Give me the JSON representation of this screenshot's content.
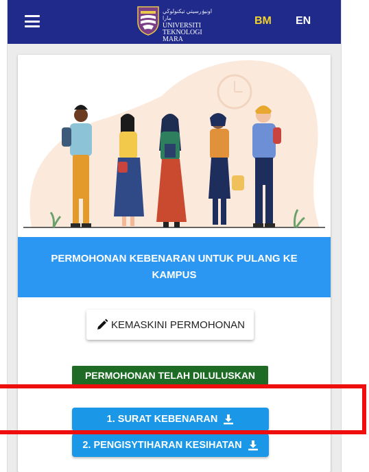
{
  "navbar": {
    "logo": {
      "arabic": "اونيۏرسيتي تيكنولوڬي مارا",
      "line1": "UNIVERSITI",
      "line2": "TEKNOLOGI",
      "line3": "MARA"
    },
    "lang_bm": "BM",
    "lang_en": "EN",
    "colors": {
      "bar": "#1f2a8a",
      "active_lang": "#f4d22e"
    }
  },
  "banner": {
    "title": "PERMOHONAN KEBENARAN UNTUK PULANG KE KAMPUS"
  },
  "actions": {
    "edit_label": "KEMASKINI PERMOHONAN",
    "status": "PERMOHONAN TELAH DILULUSKAN",
    "download_1": "1. SURAT KEBENARAN",
    "download_2": "2. PENGISYTIHARAN KESIHATAN"
  },
  "icons": [
    "menu-icon",
    "pencil-icon",
    "download-icon"
  ]
}
